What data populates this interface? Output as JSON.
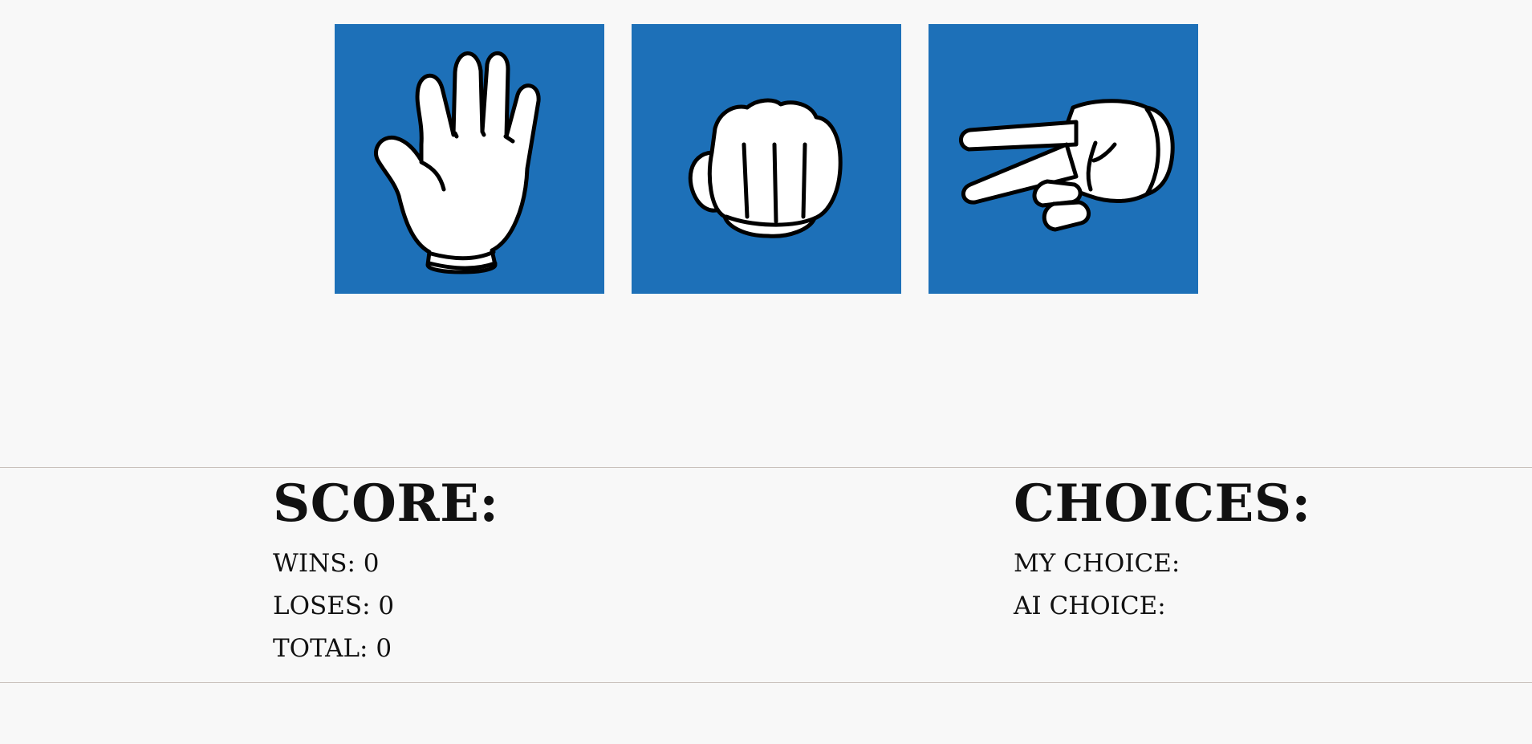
{
  "choices": [
    {
      "id": "paper",
      "icon": "open-hand-paper-icon"
    },
    {
      "id": "rock",
      "icon": "fist-rock-icon"
    },
    {
      "id": "scissors",
      "icon": "scissors-hand-icon"
    }
  ],
  "colors": {
    "tile": "#1d70b8",
    "background": "#f8f8f8",
    "divider": "#c9c1bc"
  },
  "score": {
    "heading": "SCORE:",
    "wins_label": "WINS:",
    "wins": "0",
    "loses_label": "LOSES:",
    "loses": "0",
    "total_label": "TOTAL:",
    "total": "0"
  },
  "choices_panel": {
    "heading": "CHOICES:",
    "my_choice_label": "MY CHOICE:",
    "my_choice": "",
    "ai_choice_label": "AI CHOICE:",
    "ai_choice": ""
  }
}
